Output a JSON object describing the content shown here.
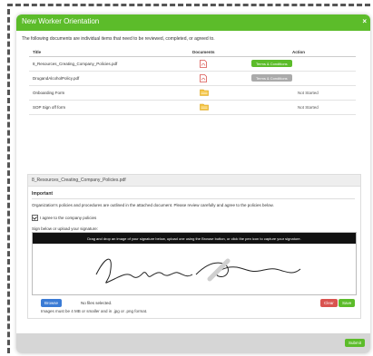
{
  "modal": {
    "title": "New Worker Orientation",
    "close_glyph": "×",
    "intro": "The following documents are individual items that need to be reviewed, completed, or agreed to."
  },
  "table": {
    "headers": {
      "title": "Title",
      "documents": "Documents",
      "action": "Action"
    },
    "rows": [
      {
        "title": "8_Resources_Creating_Company_Policies.pdf",
        "doc_icon": "pdf-icon",
        "action_type": "button",
        "action_label": "Terms & Conditions",
        "action_enabled": true
      },
      {
        "title": "DrugandAlcoholPolicy.pdf",
        "doc_icon": "pdf-icon",
        "action_type": "button",
        "action_label": "Terms & Conditions",
        "action_enabled": false
      },
      {
        "title": "Onboarding Form",
        "doc_icon": "folder-icon",
        "action_type": "status",
        "action_label": "Not Started"
      },
      {
        "title": "SOP Sign off form",
        "doc_icon": "folder-icon",
        "action_type": "status",
        "action_label": "Not Started"
      }
    ]
  },
  "panel": {
    "doc_name": "8_Resources_Creating_Company_Policies.pdf",
    "section_title": "Important",
    "policy_text": "Organization's policies and procedures are outlined in the attached document. Please review carefully and agree to the policies below.",
    "agree_label": "I agree to the company policies",
    "agree_checked": true,
    "sign_label": "Sign below or upload your signature:",
    "sig_instructions": "Drag and drop an image of your signature below, upload one using the Browse button, or click the pen icon to capture your signature.",
    "browse_label": "Browse",
    "file_status": "No files selected.",
    "clear_label": "Clear",
    "save_label": "Save",
    "image_hint": "Images must be 4 MB or smaller and in .jpg or .png format."
  },
  "footer": {
    "submit_label": "Submit"
  },
  "colors": {
    "accent": "#5cbc2a",
    "danger": "#d9534f",
    "primary": "#3a7bd5"
  }
}
